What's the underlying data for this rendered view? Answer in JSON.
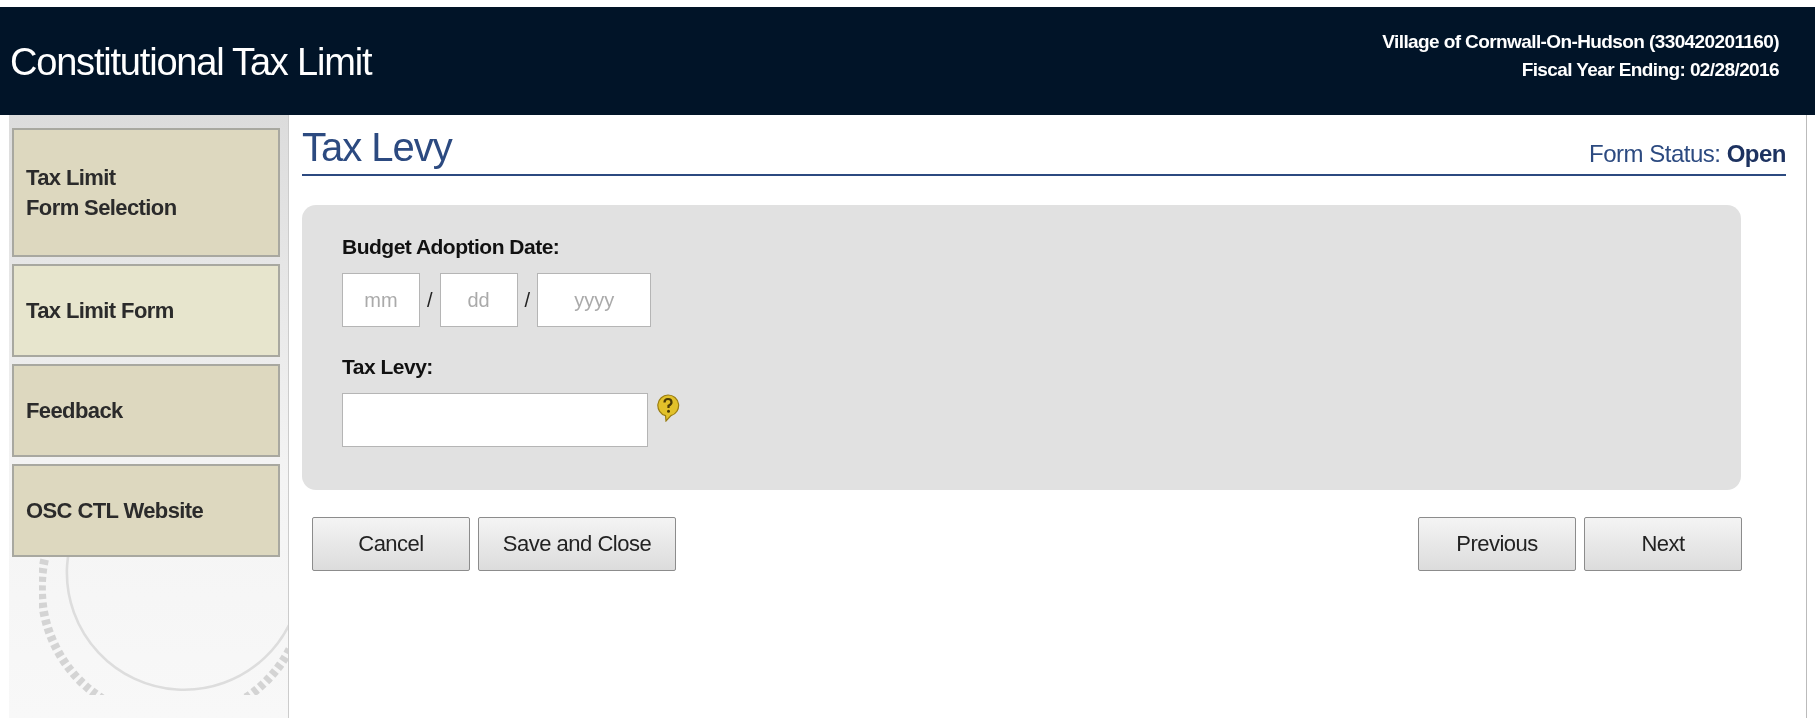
{
  "header": {
    "title": "Constitutional Tax Limit",
    "entity": "Village of Cornwall-On-Hudson (330420201160)",
    "fiscal_year": "Fiscal Year Ending: 02/28/2016"
  },
  "sidebar": {
    "items": [
      {
        "label": "Tax Limit\nForm Selection",
        "selected": false
      },
      {
        "label": "Tax Limit Form",
        "selected": true
      },
      {
        "label": "Feedback",
        "selected": false
      },
      {
        "label": "OSC CTL Website",
        "selected": false
      }
    ]
  },
  "page": {
    "title": "Tax Levy",
    "status_label": "Form Status:",
    "status": "Open"
  },
  "form": {
    "date_label": "Budget Adoption Date:",
    "date_fields": [
      {
        "placeholder": "mm"
      },
      {
        "placeholder": "dd"
      },
      {
        "placeholder": "yyyy"
      }
    ],
    "separator": "/",
    "levy_label": "Tax Levy:"
  },
  "buttons_left": [
    "Cancel",
    "Save and Close"
  ],
  "buttons_right": [
    "Previous",
    "Next"
  ]
}
